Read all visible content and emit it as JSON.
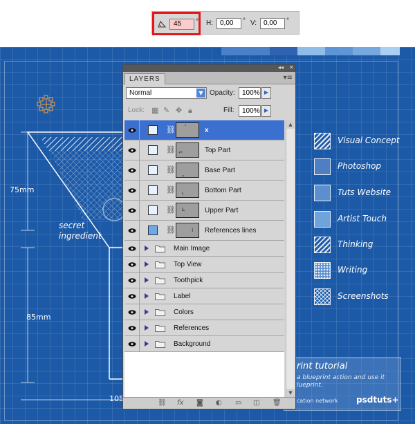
{
  "transform_bar": {
    "angle_value": "45",
    "angle_unit": "°",
    "h_label": "H:",
    "h_value": "0,00",
    "h_unit": "°",
    "v_label": "V:",
    "v_value": "0,00",
    "v_unit": "°"
  },
  "layers_panel": {
    "tab_label": "LAYERS",
    "blend_mode": "Normal",
    "opacity_label": "Opacity:",
    "opacity_value": "100%",
    "lock_label": "Lock:",
    "fill_label": "Fill:",
    "fill_value": "100%",
    "layers": [
      {
        "name": "x",
        "selected": true,
        "thumb_mark": "'"
      },
      {
        "name": "Top Part",
        "selected": false,
        "thumb_mark": "⌐"
      },
      {
        "name": "Base Part",
        "selected": false,
        "thumb_mark": "˽"
      },
      {
        "name": "Bottom Part",
        "selected": false,
        "thumb_mark": "˪"
      },
      {
        "name": "Upper Part",
        "selected": false,
        "thumb_mark": "ʟ"
      },
      {
        "name": "References lines",
        "selected": false,
        "thumb_mark": "⁞"
      }
    ],
    "groups": [
      {
        "name": "Main Image"
      },
      {
        "name": "Top View"
      },
      {
        "name": "Toothpick"
      },
      {
        "name": "Label"
      },
      {
        "name": "Colors"
      },
      {
        "name": "References"
      },
      {
        "name": "Background"
      }
    ]
  },
  "blueprint": {
    "legend": [
      {
        "label": "Visual Concept",
        "style": "hatch"
      },
      {
        "label": "Photoshop",
        "style": "solid",
        "color": "#4f7fc2"
      },
      {
        "label": "Tuts Website",
        "style": "solid",
        "color": "#5b8fd0"
      },
      {
        "label": "Artist Touch",
        "style": "solid",
        "color": "#6fa3dc"
      },
      {
        "label": "Thinking",
        "style": "hatch"
      },
      {
        "label": "Writing",
        "style": "dots"
      },
      {
        "label": "Screenshots",
        "style": "crosshatch"
      }
    ],
    "dim_75": "75mm",
    "dim_85": "85mm",
    "dim_105": "105",
    "note_line1": "secret",
    "note_line2": "ingredient",
    "tutorial_title": "rint tutorial",
    "tutorial_sub": "a blueprint action and use it lueprint.",
    "tutorial_foot": "cation network",
    "tutorial_brand": "psdtuts+"
  },
  "colors": {
    "blueprint_bg": "#1c5aa8",
    "highlight_red": "#e3171b",
    "selected_row": "#3b6fd0",
    "angle_field_bg": "#fbcccb"
  }
}
